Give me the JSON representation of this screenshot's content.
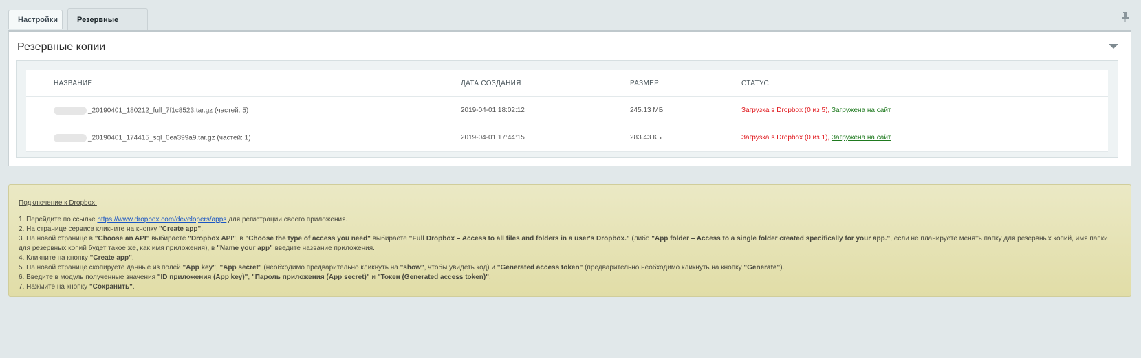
{
  "tabs": [
    {
      "label": "Настройки"
    },
    {
      "label": "Резервные копии"
    }
  ],
  "panel": {
    "title": "Резервные копии"
  },
  "table": {
    "headers": [
      "НАЗВАНИЕ",
      "ДАТА СОЗДАНИЯ",
      "РАЗМЕР",
      "СТАТУС"
    ],
    "rows": [
      {
        "name": "_20190401_180212_full_7f1c8523.tar.gz (частей: 5)",
        "date": "2019-04-01 18:02:12",
        "size": "245.13 МБ",
        "status_red": "Загрузка в Dropbox (0 из 5),",
        "status_link": "Загружена на сайт"
      },
      {
        "name": "_20190401_174415_sql_6ea399a9.tar.gz (частей: 1)",
        "date": "2019-04-01 17:44:15",
        "size": "283.43 КБ",
        "status_red": "Загрузка в Dropbox (0 из 1),",
        "status_link": "Загружена на сайт"
      }
    ]
  },
  "note": {
    "title": "Подключение к Dropbox:",
    "l1a": "1. Перейдите по ссылке ",
    "l1link": "https://www.dropbox.com/developers/apps",
    "l1b": " для регистрации своего приложения.",
    "l2a": "2. На странице сервиса кликните на кнопку ",
    "l2b": "\"Create app\"",
    "l2c": ".",
    "l3a": "3. На новой странице в ",
    "l3b": "\"Choose an API\"",
    "l3c": " выбираете ",
    "l3d": "\"Dropbox API\"",
    "l3e": ", в ",
    "l3f": "\"Choose the type of access you need\"",
    "l3g": " выбираете ",
    "l3h": "\"Full Dropbox – Access to all files and folders in a user's Dropbox.\"",
    "l3i": " (либо ",
    "l3j": "\"App folder – Access to a single folder created specifically for your app.\"",
    "l3k": ", если не планируете менять папку для резервных копий, имя папки для резервных копий будет такое же, как имя приложения), в ",
    "l3l": "\"Name your app\"",
    "l3m": " введите название приложения.",
    "l4a": "4. Кликните на кнопку ",
    "l4b": "\"Create app\"",
    "l4c": ".",
    "l5a": "5. На новой странице скопируете данные из полей ",
    "l5b": "\"App key\"",
    "l5c": ", ",
    "l5d": "\"App secret\"",
    "l5e": " (необходимо предварительно кликнуть на ",
    "l5f": "\"show\"",
    "l5g": ", чтобы увидеть код) и ",
    "l5h": "\"Generated access token\"",
    "l5i": " (предварительно необходимо кликнуть на кнопку ",
    "l5j": "\"Generate\"",
    "l5k": ").",
    "l6a": "6. Введите в модуль полученные значения ",
    "l6b": "\"ID приложения (App key)\"",
    "l6c": ", ",
    "l6d": "\"Пароль приложения (App secret)\"",
    "l6e": " и ",
    "l6f": "\"Токен (Generated access token)\"",
    "l6g": ".",
    "l7a": "7. Нажмите на кнопку ",
    "l7b": "\"Сохранить\"",
    "l7c": "."
  },
  "colors": {
    "status_red": "#e0161b",
    "status_link": "#1f7a1f",
    "note_bg": "#e6e3b4",
    "link": "#1a55c4"
  },
  "icons": {
    "pin": "pin-icon",
    "collapse": "chevron-down-icon"
  }
}
